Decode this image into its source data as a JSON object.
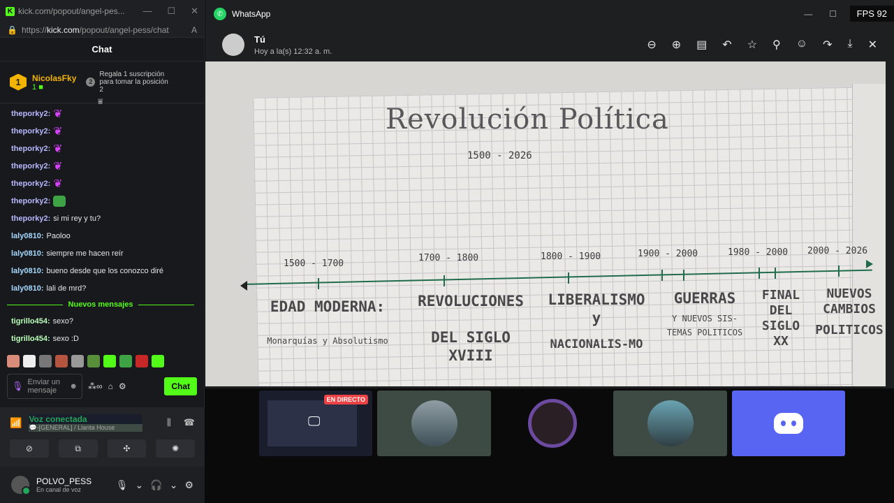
{
  "kick_window": {
    "tab_title": "kick.com/popout/angel-pes...",
    "url_prefix": "https://",
    "url_domain": "kick.com",
    "url_path": "/popout/angel-pess/chat",
    "chat_title": "Chat",
    "pinned": {
      "rank": "1",
      "name": "NicolasFky",
      "count": "1",
      "gift_num": "2",
      "gift_text": "Regala 1 suscripción para tomar la posición 2"
    },
    "messages_before": [
      {
        "user": "theporky2:",
        "text": "",
        "emote": "heart"
      },
      {
        "user": "theporky2:",
        "text": "",
        "emote": "heart"
      },
      {
        "user": "theporky2:",
        "text": "",
        "emote": "heart"
      },
      {
        "user": "theporky2:",
        "text": "",
        "emote": "heart"
      },
      {
        "user": "theporky2:",
        "text": "",
        "emote": "heart"
      },
      {
        "user": "theporky2:",
        "text": "",
        "emote": "frog"
      },
      {
        "user": "theporky2:",
        "text": "si mi rey y tu?",
        "emote": ""
      },
      {
        "user": "laly0810:",
        "text": "Paoloo",
        "emote": ""
      },
      {
        "user": "laly0810:",
        "text": "siempre me hacen reír",
        "emote": ""
      },
      {
        "user": "laly0810:",
        "text": "bueno desde que los conozco diré",
        "emote": ""
      },
      {
        "user": "laly0810:",
        "text": "lali de mrd?",
        "emote": ""
      }
    ],
    "new_messages_label": "Nuevos mensajes",
    "messages_after": [
      {
        "user": "tigrillo454:",
        "text": "sexo?"
      },
      {
        "user": "tigrillo454:",
        "text": "sexo :D"
      }
    ],
    "input_placeholder": "Enviar un mensaje",
    "send_label": "Chat",
    "user_colors": {
      "theporky2": "#b8b8ff",
      "laly0810": "#a6d9ff",
      "tigrillo454": "#b8ffb8"
    }
  },
  "discord": {
    "voice_status": "Voz conectada",
    "voice_channel": "💬‑⁠[GENERAL] / Llanta House",
    "username": "POLVO_PESS",
    "user_status": "En canal de voz"
  },
  "whatsapp": {
    "app_title": "WhatsApp",
    "fps": "FPS 92",
    "sender": "Tú",
    "time": "Hoy a la(s) 12:32 a. m.",
    "photo": {
      "title": "Revolución Política",
      "years": "1500 - 2026",
      "periods": [
        "1500 - 1700",
        "1700 - 1800",
        "1800 - 1900",
        "1900 - 2000",
        "1980 - 2000",
        "2000 - 2026"
      ],
      "eras": [
        {
          "name": "EDAD MODERNA:",
          "sub": "Monarquías y Absolutismo"
        },
        {
          "name": "REVOLUCIONES",
          "sub": "DEL SIGLO XVIII"
        },
        {
          "name": "LIBERALISMO y",
          "sub": "NACIONALIS-MO"
        },
        {
          "name": "GUERRAS",
          "sub": "Y NUEVOS SIS-TEMAS POLITICOS"
        },
        {
          "name": "FINAL DEL",
          "sub": "SIGLO XX"
        },
        {
          "name": "NUEVOS CAMBIOS",
          "sub": "POLITICOS"
        }
      ]
    }
  },
  "call": {
    "live_badge": "EN DIRECTO"
  }
}
